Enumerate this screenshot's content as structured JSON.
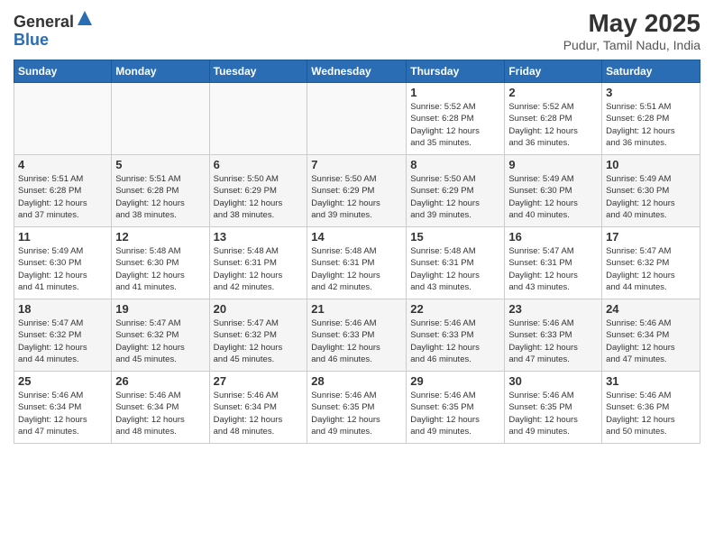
{
  "header": {
    "logo_line1": "General",
    "logo_line2": "Blue",
    "title": "May 2025",
    "subtitle": "Pudur, Tamil Nadu, India"
  },
  "weekdays": [
    "Sunday",
    "Monday",
    "Tuesday",
    "Wednesday",
    "Thursday",
    "Friday",
    "Saturday"
  ],
  "weeks": [
    [
      {
        "day": "",
        "info": ""
      },
      {
        "day": "",
        "info": ""
      },
      {
        "day": "",
        "info": ""
      },
      {
        "day": "",
        "info": ""
      },
      {
        "day": "1",
        "info": "Sunrise: 5:52 AM\nSunset: 6:28 PM\nDaylight: 12 hours\nand 35 minutes."
      },
      {
        "day": "2",
        "info": "Sunrise: 5:52 AM\nSunset: 6:28 PM\nDaylight: 12 hours\nand 36 minutes."
      },
      {
        "day": "3",
        "info": "Sunrise: 5:51 AM\nSunset: 6:28 PM\nDaylight: 12 hours\nand 36 minutes."
      }
    ],
    [
      {
        "day": "4",
        "info": "Sunrise: 5:51 AM\nSunset: 6:28 PM\nDaylight: 12 hours\nand 37 minutes."
      },
      {
        "day": "5",
        "info": "Sunrise: 5:51 AM\nSunset: 6:28 PM\nDaylight: 12 hours\nand 38 minutes."
      },
      {
        "day": "6",
        "info": "Sunrise: 5:50 AM\nSunset: 6:29 PM\nDaylight: 12 hours\nand 38 minutes."
      },
      {
        "day": "7",
        "info": "Sunrise: 5:50 AM\nSunset: 6:29 PM\nDaylight: 12 hours\nand 39 minutes."
      },
      {
        "day": "8",
        "info": "Sunrise: 5:50 AM\nSunset: 6:29 PM\nDaylight: 12 hours\nand 39 minutes."
      },
      {
        "day": "9",
        "info": "Sunrise: 5:49 AM\nSunset: 6:30 PM\nDaylight: 12 hours\nand 40 minutes."
      },
      {
        "day": "10",
        "info": "Sunrise: 5:49 AM\nSunset: 6:30 PM\nDaylight: 12 hours\nand 40 minutes."
      }
    ],
    [
      {
        "day": "11",
        "info": "Sunrise: 5:49 AM\nSunset: 6:30 PM\nDaylight: 12 hours\nand 41 minutes."
      },
      {
        "day": "12",
        "info": "Sunrise: 5:48 AM\nSunset: 6:30 PM\nDaylight: 12 hours\nand 41 minutes."
      },
      {
        "day": "13",
        "info": "Sunrise: 5:48 AM\nSunset: 6:31 PM\nDaylight: 12 hours\nand 42 minutes."
      },
      {
        "day": "14",
        "info": "Sunrise: 5:48 AM\nSunset: 6:31 PM\nDaylight: 12 hours\nand 42 minutes."
      },
      {
        "day": "15",
        "info": "Sunrise: 5:48 AM\nSunset: 6:31 PM\nDaylight: 12 hours\nand 43 minutes."
      },
      {
        "day": "16",
        "info": "Sunrise: 5:47 AM\nSunset: 6:31 PM\nDaylight: 12 hours\nand 43 minutes."
      },
      {
        "day": "17",
        "info": "Sunrise: 5:47 AM\nSunset: 6:32 PM\nDaylight: 12 hours\nand 44 minutes."
      }
    ],
    [
      {
        "day": "18",
        "info": "Sunrise: 5:47 AM\nSunset: 6:32 PM\nDaylight: 12 hours\nand 44 minutes."
      },
      {
        "day": "19",
        "info": "Sunrise: 5:47 AM\nSunset: 6:32 PM\nDaylight: 12 hours\nand 45 minutes."
      },
      {
        "day": "20",
        "info": "Sunrise: 5:47 AM\nSunset: 6:32 PM\nDaylight: 12 hours\nand 45 minutes."
      },
      {
        "day": "21",
        "info": "Sunrise: 5:46 AM\nSunset: 6:33 PM\nDaylight: 12 hours\nand 46 minutes."
      },
      {
        "day": "22",
        "info": "Sunrise: 5:46 AM\nSunset: 6:33 PM\nDaylight: 12 hours\nand 46 minutes."
      },
      {
        "day": "23",
        "info": "Sunrise: 5:46 AM\nSunset: 6:33 PM\nDaylight: 12 hours\nand 47 minutes."
      },
      {
        "day": "24",
        "info": "Sunrise: 5:46 AM\nSunset: 6:34 PM\nDaylight: 12 hours\nand 47 minutes."
      }
    ],
    [
      {
        "day": "25",
        "info": "Sunrise: 5:46 AM\nSunset: 6:34 PM\nDaylight: 12 hours\nand 47 minutes."
      },
      {
        "day": "26",
        "info": "Sunrise: 5:46 AM\nSunset: 6:34 PM\nDaylight: 12 hours\nand 48 minutes."
      },
      {
        "day": "27",
        "info": "Sunrise: 5:46 AM\nSunset: 6:34 PM\nDaylight: 12 hours\nand 48 minutes."
      },
      {
        "day": "28",
        "info": "Sunrise: 5:46 AM\nSunset: 6:35 PM\nDaylight: 12 hours\nand 49 minutes."
      },
      {
        "day": "29",
        "info": "Sunrise: 5:46 AM\nSunset: 6:35 PM\nDaylight: 12 hours\nand 49 minutes."
      },
      {
        "day": "30",
        "info": "Sunrise: 5:46 AM\nSunset: 6:35 PM\nDaylight: 12 hours\nand 49 minutes."
      },
      {
        "day": "31",
        "info": "Sunrise: 5:46 AM\nSunset: 6:36 PM\nDaylight: 12 hours\nand 50 minutes."
      }
    ]
  ]
}
